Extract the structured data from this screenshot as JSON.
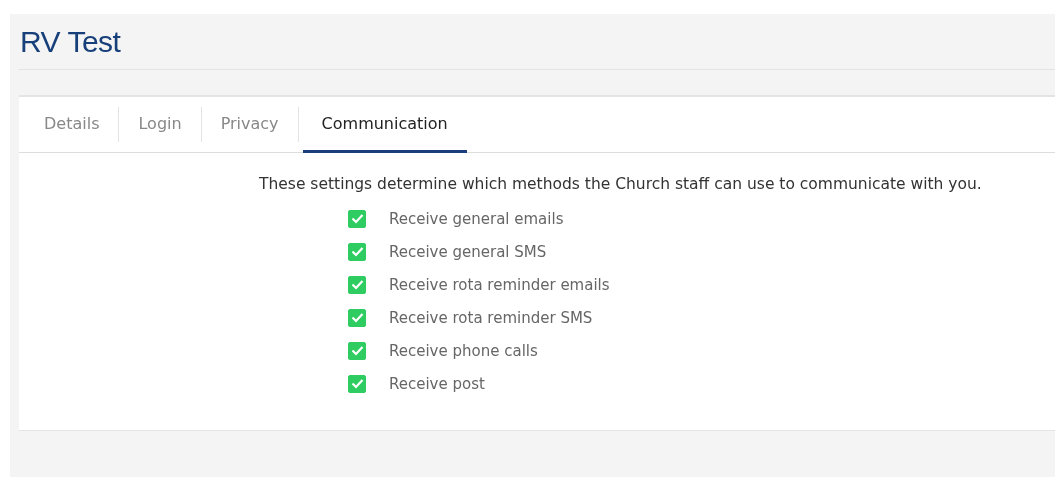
{
  "title": "RV Test",
  "tabs": [
    {
      "label": "Details",
      "selected": false
    },
    {
      "label": "Login",
      "selected": false
    },
    {
      "label": "Privacy",
      "selected": false
    },
    {
      "label": "Communication",
      "selected": true
    }
  ],
  "intro": "These settings determine which methods the Church staff can use to communicate with you.",
  "options": [
    {
      "label": "Receive general emails",
      "checked": true
    },
    {
      "label": "Receive general SMS",
      "checked": true
    },
    {
      "label": "Receive rota reminder emails",
      "checked": true
    },
    {
      "label": "Receive rota reminder SMS",
      "checked": true
    },
    {
      "label": "Receive phone calls",
      "checked": true
    },
    {
      "label": "Receive post",
      "checked": true
    }
  ]
}
